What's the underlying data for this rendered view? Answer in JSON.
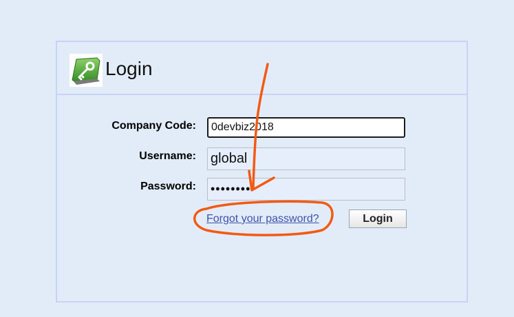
{
  "login": {
    "title": "Login",
    "company_code": {
      "label": "Company Code:",
      "value": "0devbiz2018"
    },
    "username": {
      "label": "Username:",
      "value": "global"
    },
    "password": {
      "label": "Password:",
      "value": "••••••••"
    },
    "forgot_password_link": "Forgot your password?",
    "login_button": "Login"
  },
  "colors": {
    "page_background": "#e2ecf8",
    "panel_border": "#c7d2f7",
    "link": "#3f51a8",
    "annotation": "#f25a14",
    "icon_green": "#3f9f2a"
  },
  "icons": {
    "login_icon": "key-icon"
  }
}
